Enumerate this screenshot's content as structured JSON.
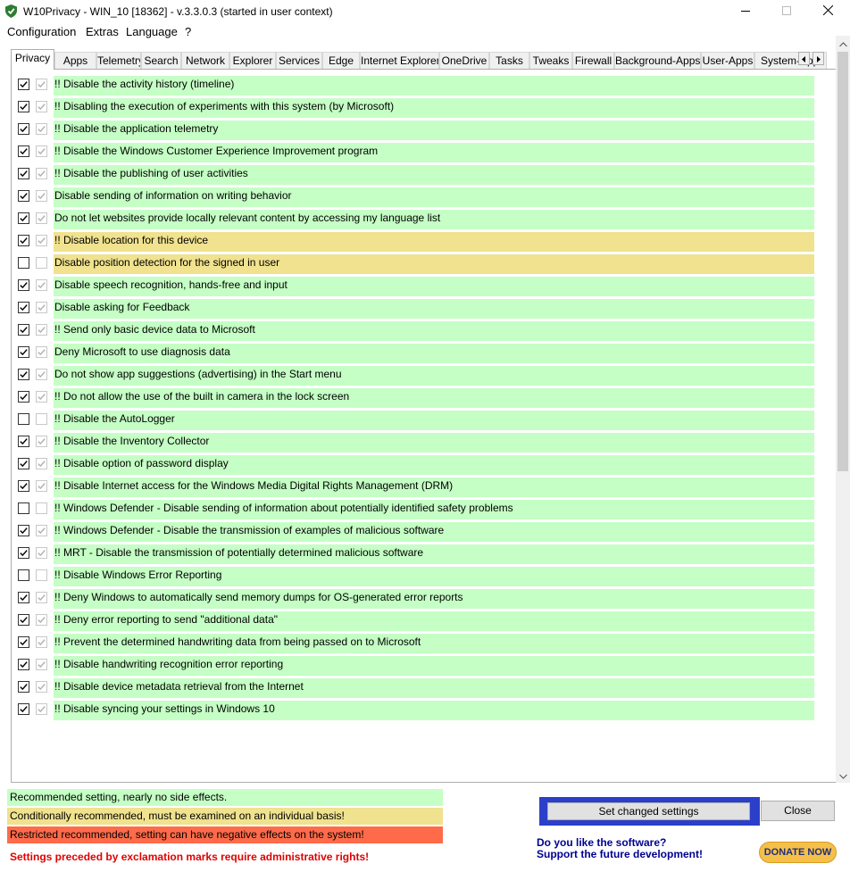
{
  "window": {
    "title": "W10Privacy - WIN_10 [18362]  - v.3.3.0.3 (started in user context)"
  },
  "menu": [
    "Configuration",
    "Extras",
    "Language",
    "?"
  ],
  "tabs": [
    {
      "label": "Privacy",
      "active": true
    },
    {
      "label": "Apps"
    },
    {
      "label": "Telemetry"
    },
    {
      "label": "Search"
    },
    {
      "label": "Network"
    },
    {
      "label": "Explorer"
    },
    {
      "label": "Services"
    },
    {
      "label": "Edge"
    },
    {
      "label": "Internet Explorer"
    },
    {
      "label": "OneDrive"
    },
    {
      "label": "Tasks"
    },
    {
      "label": "Tweaks"
    },
    {
      "label": "Firewall"
    },
    {
      "label": "Background-Apps"
    },
    {
      "label": "User-Apps"
    },
    {
      "label": "System-Apps"
    }
  ],
  "colors": {
    "recommended": "#c5ffc5",
    "conditional": "#f0e28e",
    "restricted": "#ff6b4a",
    "accent": "#2c3fc9"
  },
  "settings": [
    {
      "checked": true,
      "level": "recommended",
      "label": "!! Disable the activity history (timeline)"
    },
    {
      "checked": true,
      "level": "recommended",
      "label": "!! Disabling the execution of experiments with this system (by Microsoft)"
    },
    {
      "checked": true,
      "level": "recommended",
      "label": "!! Disable the application telemetry"
    },
    {
      "checked": true,
      "level": "recommended",
      "label": "!! Disable the Windows Customer Experience Improvement program"
    },
    {
      "checked": true,
      "level": "recommended",
      "label": "!! Disable the publishing of user activities"
    },
    {
      "checked": true,
      "level": "recommended",
      "label": "Disable sending of information on writing behavior"
    },
    {
      "checked": true,
      "level": "recommended",
      "label": "Do not let websites provide locally relevant content by accessing my language list"
    },
    {
      "checked": true,
      "level": "conditional",
      "label": "!! Disable location for this device"
    },
    {
      "checked": false,
      "level": "conditional",
      "label": "Disable position detection for the signed in user"
    },
    {
      "checked": true,
      "level": "recommended",
      "label": "Disable speech recognition, hands-free and input"
    },
    {
      "checked": true,
      "level": "recommended",
      "label": "Disable asking for Feedback"
    },
    {
      "checked": true,
      "level": "recommended",
      "label": "!! Send only basic device data to Microsoft"
    },
    {
      "checked": true,
      "level": "recommended",
      "label": "Deny Microsoft to use diagnosis data"
    },
    {
      "checked": true,
      "level": "recommended",
      "label": "Do not show app suggestions (advertising) in the Start menu"
    },
    {
      "checked": true,
      "level": "recommended",
      "label": "!! Do not allow the use of the built in camera in the lock screen"
    },
    {
      "checked": false,
      "level": "recommended",
      "label": "!! Disable the AutoLogger"
    },
    {
      "checked": true,
      "level": "recommended",
      "label": "!! Disable the Inventory Collector"
    },
    {
      "checked": true,
      "level": "recommended",
      "label": "!! Disable option of password display"
    },
    {
      "checked": true,
      "level": "recommended",
      "label": "!! Disable Internet access for the Windows Media Digital Rights Management (DRM)"
    },
    {
      "checked": false,
      "level": "recommended",
      "label": "!! Windows Defender - Disable sending of information about potentially identified safety problems"
    },
    {
      "checked": true,
      "level": "recommended",
      "label": "!! Windows Defender - Disable the transmission of examples of malicious software"
    },
    {
      "checked": true,
      "level": "recommended",
      "label": "!! MRT - Disable the transmission of potentially determined malicious software"
    },
    {
      "checked": false,
      "level": "recommended",
      "label": "!! Disable Windows Error Reporting"
    },
    {
      "checked": true,
      "level": "recommended",
      "label": "!! Deny Windows to automatically send memory dumps for OS-generated error reports"
    },
    {
      "checked": true,
      "level": "recommended",
      "label": "!! Deny error reporting to send \"additional data\""
    },
    {
      "checked": true,
      "level": "recommended",
      "label": "!! Prevent the determined handwriting data from being passed on to Microsoft"
    },
    {
      "checked": true,
      "level": "recommended",
      "label": "!! Disable handwriting recognition error reporting"
    },
    {
      "checked": true,
      "level": "recommended",
      "label": "!! Disable device metadata retrieval from the Internet"
    },
    {
      "checked": true,
      "level": "recommended",
      "label": "!! Disable syncing your settings in Windows 10"
    }
  ],
  "legend": {
    "recommended": "Recommended setting, nearly no side effects.",
    "conditional": "Conditionally recommended, must be examined on an individual basis!",
    "restricted": "Restricted recommended, setting can have negative effects on the system!"
  },
  "admin_note": "Settings preceded by exclamation marks require administrative rights!",
  "buttons": {
    "set_changed": "Set changed settings",
    "close": "Close"
  },
  "promo": {
    "line1": "Do you like the software?",
    "line2": "Support the future development!"
  },
  "donate_label": "DONATE NOW",
  "icons": {
    "app": "shield-check-icon",
    "minimize": "minimize-icon",
    "maximize": "maximize-icon",
    "close": "close-icon",
    "tab_scroll_left": "arrow-left-icon",
    "tab_scroll_right": "arrow-right-icon",
    "scroll_up": "chevron-up-icon",
    "scroll_down": "chevron-down-icon"
  }
}
